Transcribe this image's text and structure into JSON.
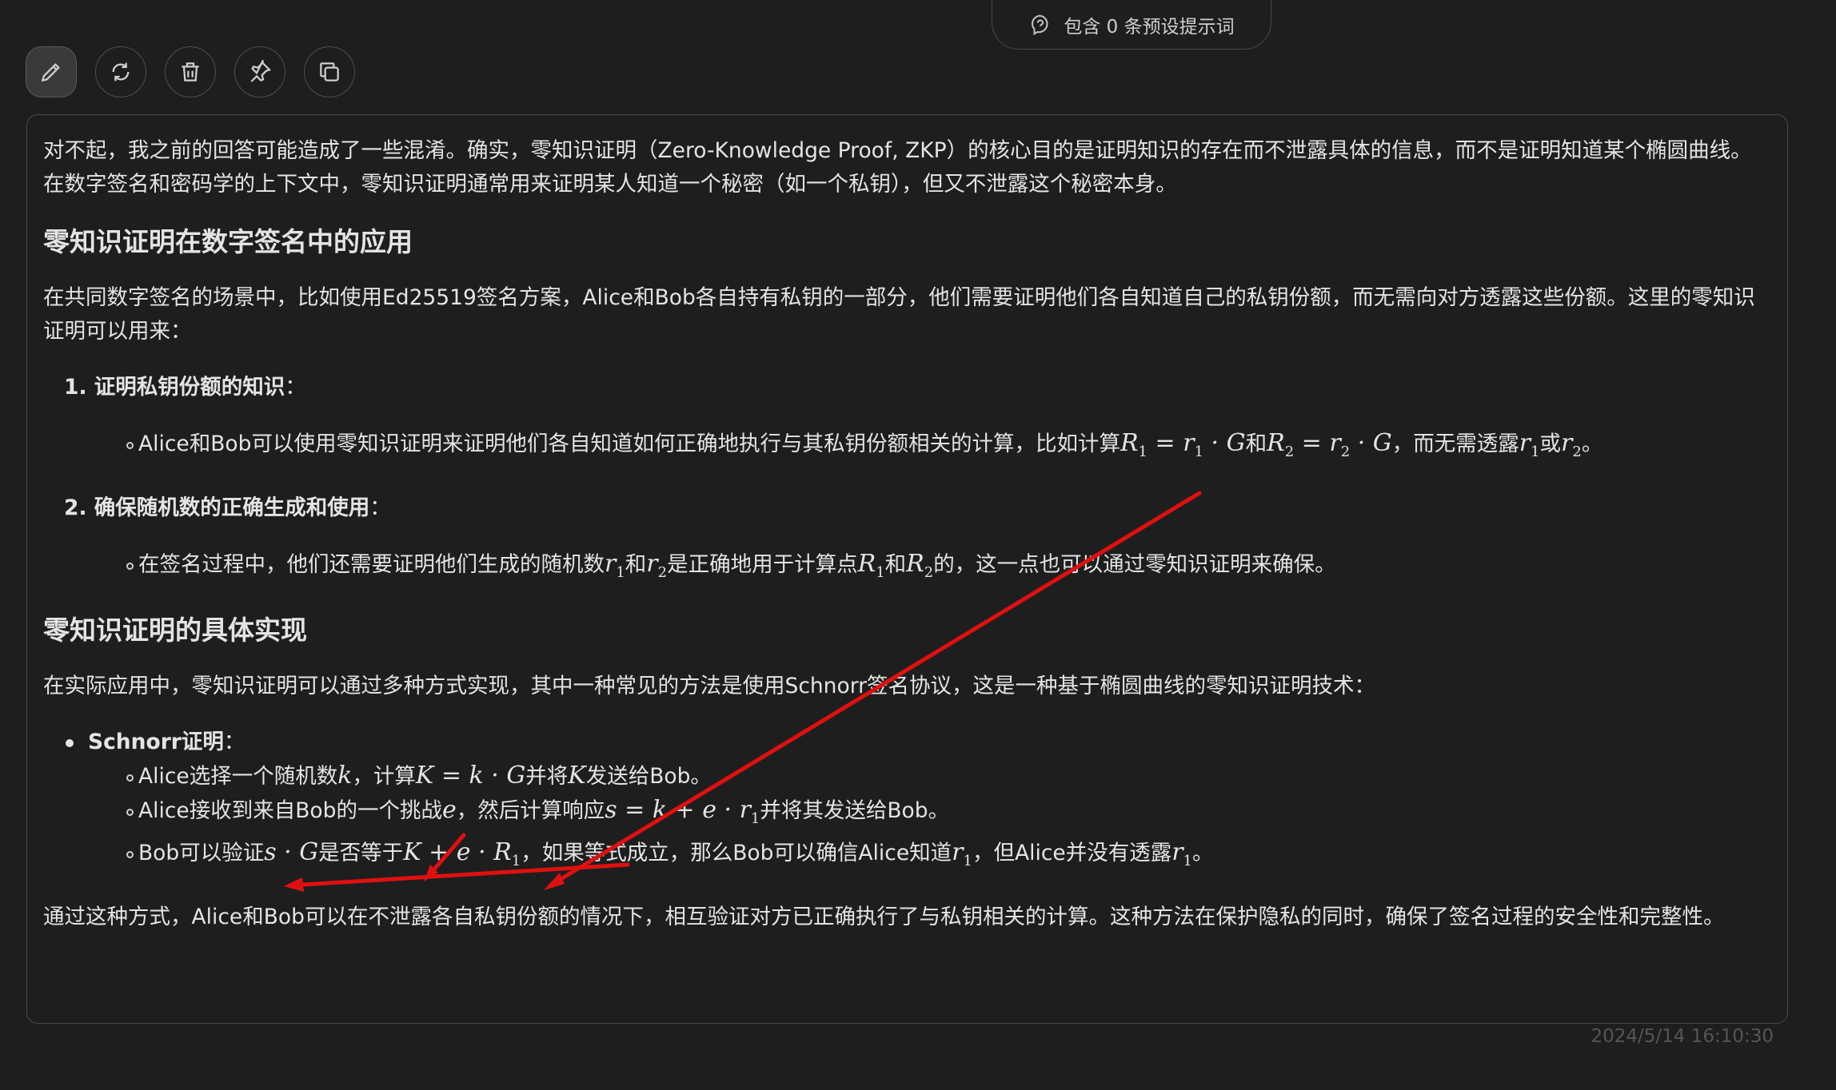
{
  "top_pill": {
    "label": "包含 0 条预设提示词",
    "icon": "preset-prompt-icon"
  },
  "toolbar": [
    {
      "name": "edit-button",
      "icon": "pencil-icon"
    },
    {
      "name": "regenerate-button",
      "icon": "refresh-icon"
    },
    {
      "name": "delete-button",
      "icon": "trash-icon"
    },
    {
      "name": "pin-button",
      "icon": "pin-icon"
    },
    {
      "name": "copy-button",
      "icon": "copy-icon"
    }
  ],
  "message": {
    "intro": "对不起，我之前的回答可能造成了一些混淆。确实，零知识证明（Zero-Knowledge Proof, ZKP）的核心目的是证明知识的存在而不泄露具体的信息，而不是证明知道某个椭圆曲线。在数字签名和密码学的上下文中，零知识证明通常用来证明某人知道一个秘密（如一个私钥），但又不泄露这个秘密本身。",
    "h1": "零知识证明在数字签名中的应用",
    "p2": "在共同数字签名的场景中，比如使用Ed25519签名方案，Alice和Bob各自持有私钥的一部分，他们需要证明他们各自知道自己的私钥份额，而无需向对方透露这些份额。这里的零知识证明可以用来：",
    "item1_title": "1. 证明私钥份额的知识",
    "item1_sub": {
      "a": "Alice和Bob可以使用零知识证明来证明他们各自知道如何正确地执行与其私钥份额相关的计算，比如计算",
      "b": "和",
      "c": "，而无需透露",
      "d": "或",
      "e": "。"
    },
    "item2_title": "2. 确保随机数的正确生成和使用",
    "item2_sub": {
      "a": "在签名过程中，他们还需要证明他们生成的随机数",
      "b": "和",
      "c": "是正确地用于计算点",
      "d": "和",
      "e": "的，这一点也可以通过零知识证明来确保。"
    },
    "h2": "零知识证明的具体实现",
    "p3": "在实际应用中，零知识证明可以通过多种方式实现，其中一种常见的方法是使用Schnorr签名协议，这是一种基于椭圆曲线的零知识证明技术：",
    "bullet_title": "Schnorr证明",
    "colon": "：",
    "steps": {
      "s1a": "Alice选择一个随机数",
      "s1b": "，计算",
      "s1c": "并将",
      "s1d": "发送给Bob。",
      "s2a": "Alice接收到来自Bob的一个挑战",
      "s2b": "，然后计算响应",
      "s2c": "并将其发送给Bob。",
      "s3a": "Bob可以验证",
      "s3b": "是否等于",
      "s3c": "，如果等式成立，那么Bob可以确信Alice知道",
      "s3d": "，但Alice并没有透露",
      "s3e": "。"
    },
    "outro": "通过这种方式，Alice和Bob可以在不泄露各自私钥份额的情况下，相互验证对方已正确执行了与私钥相关的计算。这种方法在保护隐私的同时，确保了签名过程的安全性和完整性。"
  },
  "timestamp": "2024/5/14 16:10:30",
  "annotation_color": "#e01010"
}
